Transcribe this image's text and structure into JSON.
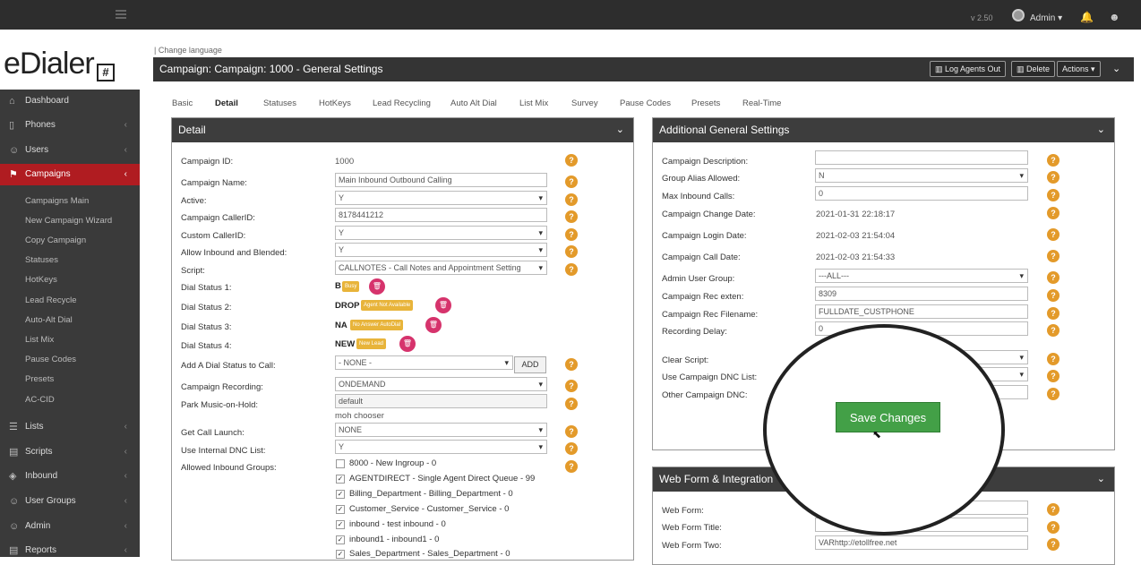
{
  "topbar": {
    "version": "v 2.50",
    "user": "Admin ▾"
  },
  "logo": {
    "text": "eDialer",
    "mark": "#"
  },
  "sidebar": {
    "items": [
      {
        "label": "Dashboard",
        "icon": "⌂"
      },
      {
        "label": "Phones",
        "icon": "▯"
      },
      {
        "label": "Users",
        "icon": "☺"
      },
      {
        "label": "Campaigns",
        "icon": "⚑"
      },
      {
        "label": "Lists",
        "icon": "☰"
      },
      {
        "label": "Scripts",
        "icon": "▤"
      },
      {
        "label": "Inbound",
        "icon": "◈"
      },
      {
        "label": "User Groups",
        "icon": "☺"
      },
      {
        "label": "Admin",
        "icon": "☺"
      },
      {
        "label": "Reports",
        "icon": "▤"
      }
    ],
    "submenu": [
      "Campaigns Main",
      "New Campaign Wizard",
      "Copy Campaign",
      "Statuses",
      "HotKeys",
      "Lead Recycle",
      "Auto-Alt Dial",
      "List Mix",
      "Pause Codes",
      "Presets",
      "AC-CID"
    ]
  },
  "header": {
    "change_language": "| Change language",
    "title": "Campaign: Campaign: 1000 - General Settings",
    "log_agents_out": "Log Agents Out",
    "delete": "Delete",
    "actions": "Actions ▾"
  },
  "tabs": [
    "Basic",
    "Detail",
    "Statuses",
    "HotKeys",
    "Lead Recycling",
    "Auto Alt Dial",
    "List Mix",
    "Survey",
    "Pause Codes",
    "Presets",
    "Real-Time"
  ],
  "detail": {
    "title": "Detail",
    "campaign_id_label": "Campaign ID:",
    "campaign_id": "1000",
    "campaign_name_label": "Campaign Name:",
    "campaign_name": "Main Inbound Outbound Calling",
    "active_label": "Active:",
    "active": "Y",
    "callerid_label": "Campaign CallerID:",
    "callerid": "8178441212",
    "custom_callerid_label": "Custom CallerID:",
    "custom_callerid": "Y",
    "allow_inbound_label": "Allow Inbound and Blended:",
    "allow_inbound": "Y",
    "script_label": "Script:",
    "script": "CALLNOTES - Call Notes and Appointment Setting",
    "dial_status_1_label": "Dial Status 1:",
    "ds1_code": "B",
    "ds1_name": "Busy",
    "dial_status_2_label": "Dial Status 2:",
    "ds2_code": "DROP",
    "ds2_name": "Agent Not Available",
    "dial_status_3_label": "Dial Status 3:",
    "ds3_code": "NA",
    "ds3_name": "No Answer AutoDial",
    "dial_status_4_label": "Dial Status 4:",
    "ds4_code": "NEW",
    "ds4_name": "New Lead",
    "add_dial_status_label": "Add A Dial Status to Call:",
    "add_dial_status": "- NONE -",
    "add_button": "ADD",
    "recording_label": "Campaign Recording:",
    "recording": "ONDEMAND",
    "park_label": "Park Music-on-Hold:",
    "park": "default",
    "moh_chooser": "moh chooser",
    "call_launch_label": "Get Call Launch:",
    "call_launch": "NONE",
    "internal_dnc_label": "Use Internal DNC List:",
    "internal_dnc": "Y",
    "allowed_groups_label": "Allowed Inbound Groups:",
    "groups": [
      {
        "label": "8000 - New Ingroup - 0",
        "checked": false
      },
      {
        "label": "AGENTDIRECT - Single Agent Direct Queue - 99",
        "checked": true
      },
      {
        "label": "Billing_Department - Billing_Department - 0",
        "checked": true
      },
      {
        "label": "Customer_Service - Customer_Service - 0",
        "checked": true
      },
      {
        "label": "inbound - test inbound - 0",
        "checked": true
      },
      {
        "label": "inbound1 - inbound1 - 0",
        "checked": true
      },
      {
        "label": "Sales_Department - Sales_Department - 0",
        "checked": true
      }
    ]
  },
  "additional": {
    "title": "Additional General Settings",
    "description_label": "Campaign Description:",
    "description": "",
    "group_alias_label": "Group Alias Allowed:",
    "group_alias": "N",
    "max_inbound_label": "Max Inbound Calls:",
    "max_inbound": "0",
    "change_date_label": "Campaign Change Date:",
    "change_date": "2021-01-31 22:18:17",
    "login_date_label": "Campaign Login Date:",
    "login_date": "2021-02-03 21:54:04",
    "call_date_label": "Campaign Call Date:",
    "call_date": "2021-02-03 21:54:33",
    "admin_group_label": "Admin User Group:",
    "admin_group": "---ALL---",
    "rec_exten_label": "Campaign Rec exten:",
    "rec_exten": "8309",
    "rec_filename_label": "Campaign Rec Filename:",
    "rec_filename": "FULLDATE_CUSTPHONE",
    "rec_delay_label": "Recording Delay:",
    "rec_delay": "0",
    "clear_script_label": "Clear Script:",
    "campaign_dnc_label": "Use Campaign DNC List:",
    "other_dnc_label": "Other Campaign DNC:",
    "save": "Save Changes"
  },
  "webform": {
    "title": "Web Form & Integration",
    "web_form_label": "Web Form:",
    "web_form_title_label": "Web Form Title:",
    "web_form_two_label": "Web Form Two:",
    "web_form_two": "VARhttp://etollfree.net"
  },
  "help_glyph": "?",
  "trash_glyph": "🗑",
  "icons": {
    "bell": "bell-icon",
    "users": "users-icon",
    "chart": "chart-icon",
    "trash": "trash-icon"
  },
  "colors": {
    "active_nav": "#b01c21",
    "help": "#e39a2a",
    "save": "#43a047",
    "badge": "#e8b43a",
    "trash": "#d6336c"
  }
}
